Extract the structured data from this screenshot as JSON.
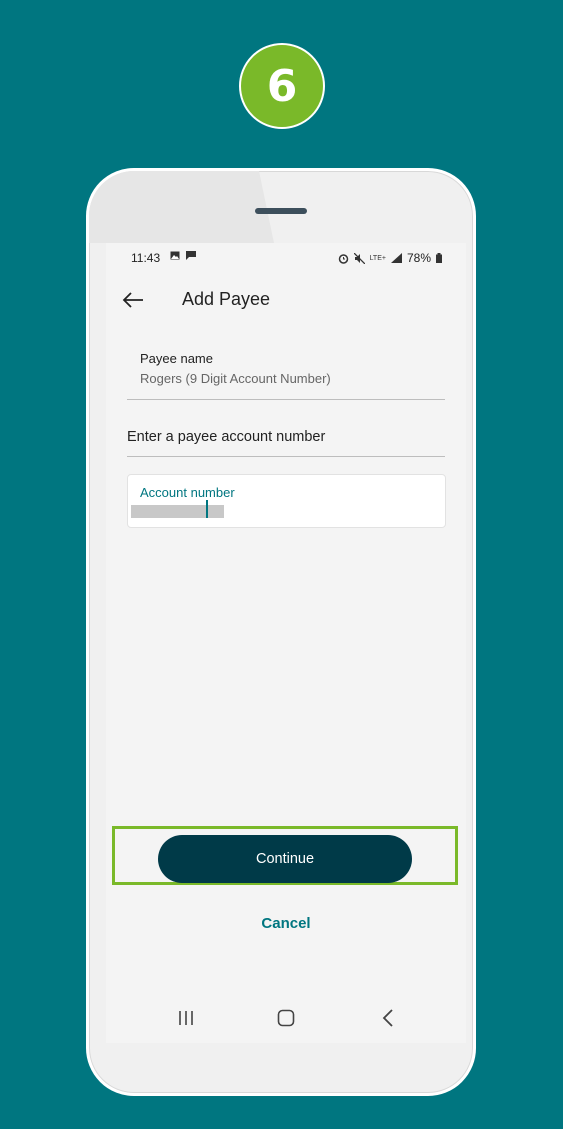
{
  "step": {
    "number": "6"
  },
  "status_bar": {
    "time": "11:43",
    "left_icons": [
      "image-icon",
      "message-icon"
    ],
    "right_icons": [
      "alarm-icon",
      "mute-icon",
      "lte-icon",
      "signal-icon"
    ],
    "lte_label": "LTE+",
    "battery": "78%"
  },
  "app_bar": {
    "title": "Add Payee"
  },
  "payee": {
    "label": "Payee name",
    "value": "Rogers (9 Digit Account Number)"
  },
  "account_section": {
    "heading": "Enter a payee account number"
  },
  "account_field": {
    "label": "Account number",
    "value_redacted": true
  },
  "actions": {
    "continue_label": "Continue",
    "cancel_label": "Cancel"
  },
  "nav": {
    "items": [
      "recent-apps-icon",
      "home-icon",
      "back-icon"
    ]
  },
  "colors": {
    "background": "#007680",
    "badge": "#7ab929",
    "primary_button": "#003a48",
    "accent_text": "#007680",
    "highlight": "#7ab929"
  }
}
